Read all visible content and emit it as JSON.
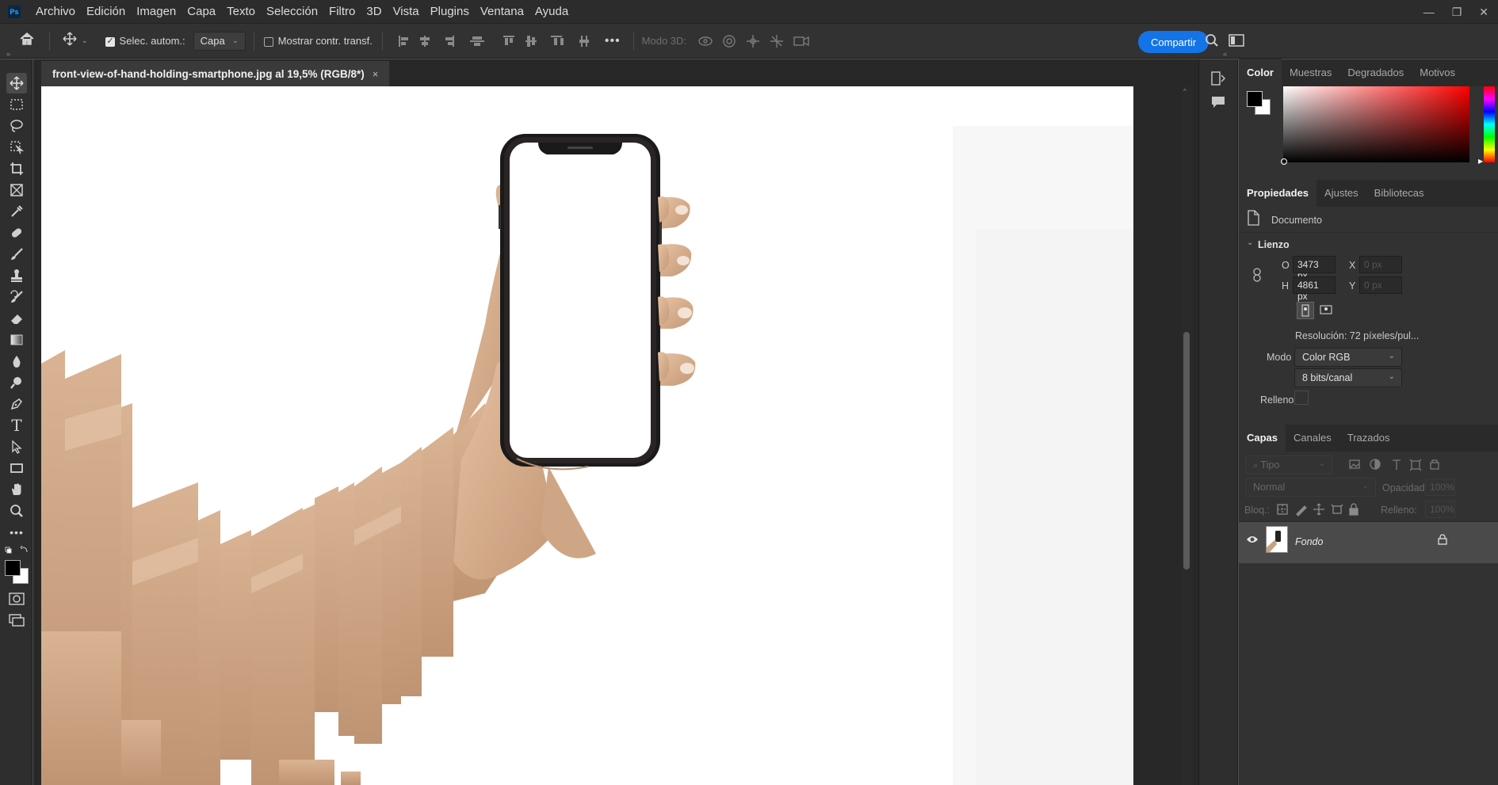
{
  "app": {
    "logo": "Ps",
    "menu": [
      "Archivo",
      "Edición",
      "Imagen",
      "Capa",
      "Texto",
      "Selección",
      "Filtro",
      "3D",
      "Vista",
      "Plugins",
      "Ventana",
      "Ayuda"
    ]
  },
  "options_bar": {
    "auto_select_label": "Selec. autom.:",
    "auto_select_checked": true,
    "auto_select_target": "Capa",
    "show_transform_label": "Mostrar contr. transf.",
    "show_transform_checked": false,
    "mode3d_label": "Modo 3D:",
    "more_label": "•••",
    "share_label": "Compartir"
  },
  "document": {
    "tab_title": "front-view-of-hand-holding-smartphone.jpg al 19,5% (RGB/8*)",
    "close_label": "×"
  },
  "color_panel": {
    "tabs": [
      "Color",
      "Muestras",
      "Degradados",
      "Motivos"
    ],
    "active_tab": "Color",
    "foreground": "#000000",
    "background": "#ffffff",
    "hue_color": "#ff0000"
  },
  "properties_panel": {
    "tabs": [
      "Propiedades",
      "Ajustes",
      "Bibliotecas"
    ],
    "active_tab": "Propiedades",
    "doc_label": "Documento",
    "section": "Lienzo",
    "width_label": "O",
    "width_value": "3473 px",
    "height_label": "H",
    "height_value": "4861 px",
    "x_label": "X",
    "x_placeholder": "0 px",
    "y_label": "Y",
    "y_placeholder": "0 px",
    "resolution": "Resolución: 72 píxeles/pul...",
    "mode_label": "Modo",
    "mode_value": "Color RGB",
    "depth_value": "8 bits/canal",
    "fill_label": "Relleno"
  },
  "layers_panel": {
    "tabs": [
      "Capas",
      "Canales",
      "Trazados"
    ],
    "active_tab": "Capas",
    "filter_placeholder": "Tipo",
    "blend_mode": "Normal",
    "opacity_label": "Opacidad:",
    "opacity_value": "100%",
    "lock_label": "Bloq.:",
    "fill_label": "Relleno:",
    "fill_value": "100%",
    "layers": [
      {
        "name": "Fondo",
        "visible": true,
        "locked": true
      }
    ]
  },
  "colors": {
    "accent": "#1473e6",
    "menubar_bg": "#2c2c2c",
    "panel_bg": "#323232",
    "skin": "#d8b292"
  },
  "tools": [
    "move-icon",
    "marquee-icon",
    "lasso-icon",
    "object-select-icon",
    "crop-icon",
    "frame-icon",
    "eyedropper-icon",
    "healing-icon",
    "brush-icon",
    "stamp-icon",
    "history-brush-icon",
    "eraser-icon",
    "gradient-icon",
    "blur-icon",
    "dodge-icon",
    "pen-icon",
    "type-icon",
    "path-select-icon",
    "rectangle-icon",
    "hand-icon",
    "zoom-icon",
    "more-tools-icon"
  ]
}
